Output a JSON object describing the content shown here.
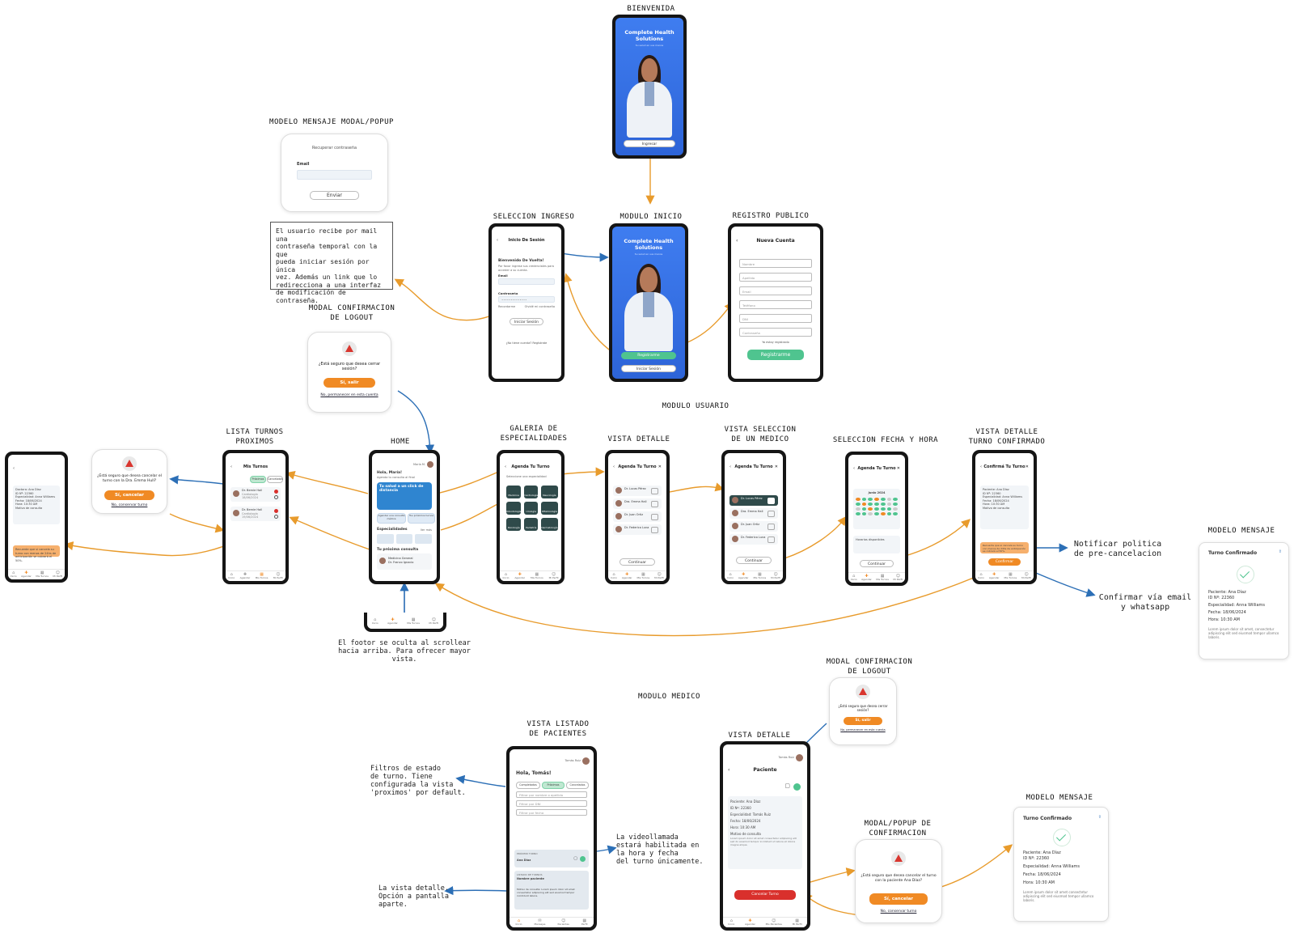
{
  "sections": {
    "bienvenida": "BIENVENIDA",
    "modelo_mensaje_modal": "MODELO MENSAJE MODAL/POPUP",
    "seleccion_ingreso": "SELECCION INGRESO",
    "modulo_inicio": "MODULO INICIO",
    "registro_publico": "REGISTRO PUBLICO",
    "modal_logout": "MODAL CONFIRMACION\nDE LOGOUT",
    "modulo_usuario": "MODULO USUARIO",
    "lista_turnos": "LISTA TURNOS\nPROXIMOS",
    "home": "HOME",
    "galeria": "GALERIA DE\nESPECIALIDADES",
    "vista_detalle": "VISTA DETALLE",
    "vista_seleccion_medico": "VISTA SELECCION\nDE UN MEDICO",
    "seleccion_fecha": "SELECCION FECHA Y HORA",
    "vista_detalle_turno": "VISTA DETALLE\nTURNO CONFIRMADO",
    "modelo_mensaje": "MODELO MENSAJE",
    "modulo_medico": "MODULO MEDICO",
    "vista_listado_pacientes": "VISTA LISTADO\nDE PACIENTES",
    "vista_detalle_medico": "VISTA DETALLE",
    "modal_logout_medico": "MODAL CONFIRMACION\nDE LOGOUT",
    "modal_confirmacion": "MODAL/POPUP DE\nCONFIRMACION",
    "modelo_mensaje_medico": "MODELO MENSAJE"
  },
  "notes": {
    "password_mail": "El usuario recibe por mail una\ncontraseña temporal con la que\npueda iniciar sesión por única\nvez. Además un link que lo\nredirecciona a una interfaz\nde modificación de contraseña.",
    "footer_scroll": "El footor se oculta al scrollear\nhacia arriba. Para ofrecer mayor vista.",
    "notificar": "Notificar politica\nde pre-cancelacion",
    "confirmar": "Confirmar vía email\ny whatsapp",
    "filtros": "Filtros de estado\nde turno. Tiene\nconfigurada la vista\n'proximos' por default.",
    "videollamada": "La videollamada\nestará habilitada en\nla hora y fecha\ndel turno únicamente.",
    "vista_detalle_note": "La vista detalle.\nOpción a pantalla\naparte."
  },
  "welcome": {
    "brand": "Complete Health\nSolutions",
    "brand_sub": "Su salud en sus manos",
    "ingresar": "Ingresar",
    "registrarme": "Registrarme",
    "iniciar_sesion": "Iniciar Sesión"
  },
  "recover": {
    "title": "Recuperar contraseña",
    "email_label": "Email",
    "send": "Enviar"
  },
  "login": {
    "header": "Inicio De Sesión",
    "welcome": "Bienvenido De Vuelta!",
    "subtitle": "Por favor ingrese sus credenciales para acceder a su cuenta.",
    "email": "Email",
    "password": "Contraseña",
    "password_mask": "••••••••••••••",
    "remember": "Recordarme",
    "forgot": "Olvidé mi contraseña",
    "submit": "Iniciar Sesión",
    "signup": "¿No tiene cuenta? Regístrate"
  },
  "register": {
    "header": "Nueva Cuenta",
    "fields": [
      "Nombre",
      "Apellido",
      "Email",
      "Teléfono",
      "DNI",
      "Contraseña"
    ],
    "already": "Ya estoy registrado",
    "submit": "Registrarme"
  },
  "logout_modal": {
    "question": "¿Está seguro que desea cerrar sesión?",
    "confirm": "Sí, salir",
    "cancel": "No, permanecer en esta cuenta"
  },
  "cancel_modal": {
    "question": "¿Está seguro que desea cancelar el turno con la Dra. Emma Hull?",
    "confirm": "Sí, cancelar",
    "cancel": "No, conservar turno"
  },
  "home": {
    "user": "María M.",
    "greeting": "Hola, María!",
    "subtitle": "Agenda tu consulta al final",
    "banner": "Tu salud a un click de distancia",
    "btn_agendar": "Agendar una consulta médica",
    "btn_proximos": "Tus próximos turnos",
    "especialidades": "Especialidades",
    "ver_mas": "Ver más",
    "proxima": "Tu próxima consulta",
    "proxima_medico": "Medicina General\nDr. Franco Ignacio",
    "footer": [
      "Inicio",
      "Agendar",
      "Mis Turnos",
      "Mi Perfil"
    ]
  },
  "turnos": {
    "header": "Mis Turnos",
    "filter_on": "Próximos",
    "filter_off": "Cancelados",
    "items": [
      {
        "name": "Dr. Bernie Hall",
        "spec": "Cardiología\n18/06/2024"
      },
      {
        "name": "Dr. Bernie Hall",
        "spec": "Cardiología\n19/06/2024"
      }
    ]
  },
  "detalle_turno_left": {
    "doctor": "Doctora: Ana Díaz",
    "id": "ID Nº: 22360",
    "espec": "Especialidad: Anna Williams",
    "fecha": "Fecha: 18/06/2024",
    "hora": "Hora: 10:30 AM",
    "motivo": "Motivo de consulta"
  },
  "galeria": {
    "header": "Agenda Tu Turno",
    "subtitle": "Seleccione una especialidad",
    "tiles": [
      "Medicina General",
      "Cardiología",
      "Neurología",
      "Odontología",
      "Urología",
      "Oftalmología",
      "Psicología",
      "Pediatría",
      "Dermatología"
    ]
  },
  "detalle": {
    "header": "Agenda Tu Turno",
    "doctors": [
      "Dr. Lucas Pérez",
      "Dra. Emma Hall",
      "Dr. Juan Ortiz",
      "Dr. Federico Luna"
    ],
    "confirm": "Continuar"
  },
  "seleccion_medico": {
    "header": "Agenda Tu Turno",
    "doctors": [
      "Dr. Lucas Pérez",
      "Dra. Emma Hall",
      "Dr. Juan Ortiz",
      "Dr. Federico Luna"
    ],
    "confirm": "Continuar"
  },
  "fecha_hora": {
    "header": "Agenda Tu Turno",
    "month": "Junio 2024",
    "horarios": "Horarios disponibles",
    "confirm": "Continuar"
  },
  "turno_confirmado": {
    "header": "Confirmá Tu Turno",
    "paciente": "Paciente: Ana Díaz",
    "id": "ID Nº: 22360",
    "espec": "Especialidad: Anna Williams",
    "fecha": "Fecha: 18/06/2024",
    "hora": "Hora: 10:30 AM",
    "motivo": "Motivo de consulta",
    "warning": "Recuerde que si cancela su turno con menos de 24hs de anticipación se cobrará el 50%.",
    "confirm": "Confirmar"
  },
  "mensaje_user": {
    "title": "Turno Confirmado",
    "lines": [
      "Paciente: Ana Díaz",
      "ID Nº: 22360",
      "Especialidad: Anna Williams",
      "Fecha: 18/06/2024",
      "Hora: 10:30 AM"
    ],
    "footer": "Lorem ipsum dolor sit amet, consectetur adipiscing elit sed eiusmod tempor ullamco laboris."
  },
  "pacientes": {
    "user": "Tomás Ruiz",
    "greeting": "Hola, Tomás!",
    "chips": [
      "Completados",
      "Próximos",
      "Cancelados"
    ],
    "search1": "Filtrar por nombre o apellido",
    "search2": "Filtrar por DNI",
    "search3": "Filtrar por fecha",
    "card1_title": "PRÓXIMO TURNO",
    "card1_name": "Ana Díaz",
    "card2_title": "LISTADO DE TURNOS",
    "card2_name": "Nombre paciente",
    "card2_body": "Motivo de consulta: Lorem ipsum dolor sit amet consectetur adipiscing elit sed eiusmod tempor incididunt labore.",
    "footer": [
      "Inicio",
      "Mensajes",
      "Pacientes",
      "Perfil"
    ]
  },
  "detalle_medico": {
    "user": "Tomás Ruiz",
    "header": "Paciente",
    "lines": [
      "Paciente: Ana Díaz",
      "ID Nº: 22360",
      "Especialidad: Tomás Ruiz",
      "Fecha: 18/06/2024",
      "Hora: 10:30 AM",
      "Motivo de consulta"
    ],
    "body": "Lorem ipsum dolor sit amet consectetur adipiscing elit sed do eiusmod tempor incididunt ut labore et dolore magna aliqua.",
    "cancel": "Cancelar Turno",
    "footer": [
      "Inicio",
      "Agendar",
      "Mis Pacientes",
      "Mi Perfil"
    ]
  },
  "logout_medico": {
    "question": "¿Está seguro que desea cerrar sesión?",
    "confirm": "Sí, salir",
    "cancel": "No, permanecer en esta cuenta"
  },
  "cancel_medico": {
    "question": "¿Está seguro que desea cancelar el turno con la paciente Ana Díaz?",
    "confirm": "Sí, cancelar",
    "cancel": "No, conservar turno"
  },
  "mensaje_medico": {
    "title": "Turno Confirmado",
    "lines": [
      "Paciente: Ana Díaz",
      "ID Nº: 22360",
      "Especialidad: Anna Williams",
      "Fecha: 18/06/2024",
      "Hora: 10:30 AM"
    ],
    "footer": "Lorem ipsum dolor sit amet consectetur adipiscing elit sed eiusmod tempor ullamco laboris."
  },
  "colors": {
    "orange_arrow": "#e89b2c",
    "blue_arrow": "#2c6fb6",
    "brand_blue": "#3f7df0",
    "green": "#4fc48f",
    "orange": "#f08a24",
    "red": "#d9302c"
  }
}
